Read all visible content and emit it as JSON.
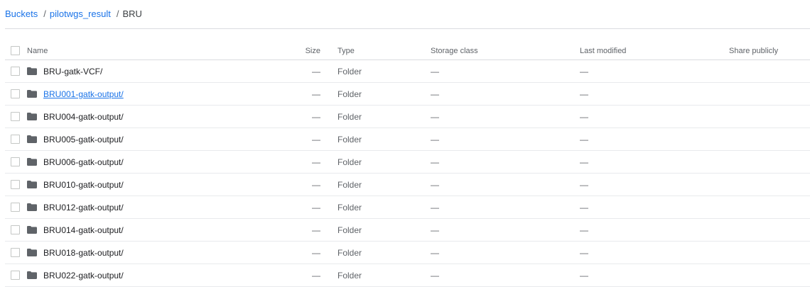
{
  "breadcrumb": {
    "root": "Buckets",
    "separator1": "/",
    "bucket": "pilotwgs_result",
    "separator2": "/",
    "current": "BRU"
  },
  "table": {
    "columns": {
      "name": "Name",
      "size": "Size",
      "type": "Type",
      "storage_class": "Storage class",
      "last_modified": "Last modified",
      "share_publicly": "Share publicly"
    },
    "rows": [
      {
        "name": "BRU-gatk-VCF/",
        "size": "—",
        "type": "Folder",
        "storage_class": "—",
        "last_modified": "—",
        "share_publicly": ""
      },
      {
        "name": "BRU001-gatk-output/",
        "size": "—",
        "type": "Folder",
        "storage_class": "—",
        "last_modified": "—",
        "share_publicly": ""
      },
      {
        "name": "BRU004-gatk-output/",
        "size": "—",
        "type": "Folder",
        "storage_class": "—",
        "last_modified": "—",
        "share_publicly": ""
      },
      {
        "name": "BRU005-gatk-output/",
        "size": "—",
        "type": "Folder",
        "storage_class": "—",
        "last_modified": "—",
        "share_publicly": ""
      },
      {
        "name": "BRU006-gatk-output/",
        "size": "—",
        "type": "Folder",
        "storage_class": "—",
        "last_modified": "—",
        "share_publicly": ""
      },
      {
        "name": "BRU010-gatk-output/",
        "size": "—",
        "type": "Folder",
        "storage_class": "—",
        "last_modified": "—",
        "share_publicly": ""
      },
      {
        "name": "BRU012-gatk-output/",
        "size": "—",
        "type": "Folder",
        "storage_class": "—",
        "last_modified": "—",
        "share_publicly": ""
      },
      {
        "name": "BRU014-gatk-output/",
        "size": "—",
        "type": "Folder",
        "storage_class": "—",
        "last_modified": "—",
        "share_publicly": ""
      },
      {
        "name": "BRU018-gatk-output/",
        "size": "—",
        "type": "Folder",
        "storage_class": "—",
        "last_modified": "—",
        "share_publicly": ""
      },
      {
        "name": "BRU022-gatk-output/",
        "size": "—",
        "type": "Folder",
        "storage_class": "—",
        "last_modified": "—",
        "share_publicly": ""
      }
    ],
    "hovered_row_index": 1,
    "row_icon": "folder-icon"
  },
  "colors": {
    "link": "#1a73e8",
    "folder_icon": "#5f6368",
    "divider": "#dadce0"
  }
}
